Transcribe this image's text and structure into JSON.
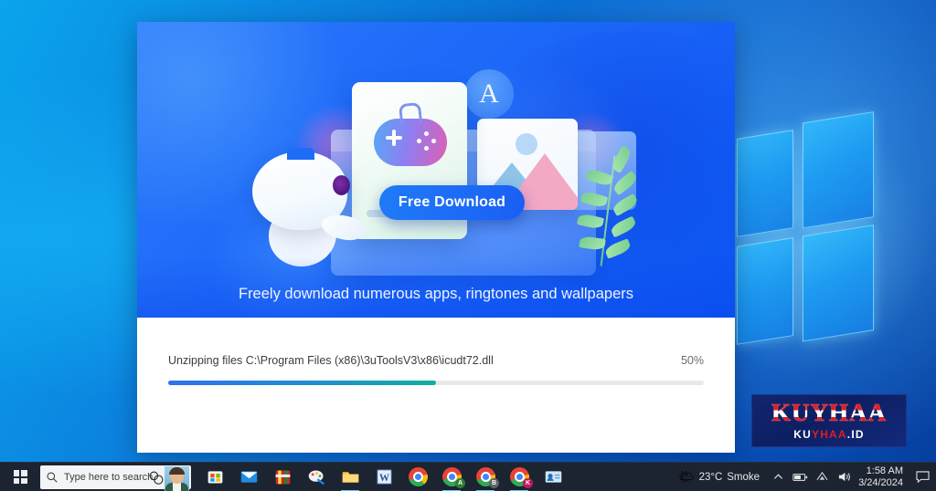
{
  "desktop": {
    "os_logo": "windows-logo"
  },
  "installer": {
    "banner": {
      "button_label": "Free Download",
      "tagline": "Freely download numerous apps, ringtones and wallpapers",
      "icons": {
        "gamepad": "gamepad-icon",
        "appstore": "A",
        "photo": "photo-icon",
        "mascot": "dolphin-mascot",
        "branch": "leaf-branch"
      }
    },
    "progress": {
      "status": "Unzipping files  C:\\Program Files (x86)\\3uToolsV3\\x86\\icudt72.dll",
      "percent_label": "50%",
      "percent_value": 50,
      "fill_start_color": "#2f72ef",
      "fill_end_color": "#12ae9e",
      "track_color": "#e9e9e9"
    }
  },
  "watermark": {
    "main": "KUYHAA",
    "sub_prefix": "KU",
    "sub_accent": "YHAA",
    "sub_suffix": ".ID",
    "sub_full": "KUYHAA.ID",
    "bg_color": "#12256e",
    "accent_color": "#e11b22"
  },
  "taskbar": {
    "start": "windows-start",
    "search": {
      "placeholder": "Type here to search",
      "icon": "search-icon"
    },
    "cortana": "cortana-icon",
    "avatar": "user-avatar",
    "apps": [
      {
        "name": "microsoft-store",
        "label": "Microsoft Store",
        "type": "store",
        "active": false
      },
      {
        "name": "mail",
        "label": "Mail",
        "type": "mail",
        "active": false
      },
      {
        "name": "winrar",
        "label": "WinRAR",
        "type": "winrar",
        "active": false
      },
      {
        "name": "paint",
        "label": "Paint",
        "type": "paint",
        "active": false
      },
      {
        "name": "file-explorer",
        "label": "File Explorer",
        "type": "folder",
        "active": true
      },
      {
        "name": "word",
        "label": "Word",
        "type": "word",
        "active": false
      },
      {
        "name": "chrome",
        "label": "Google Chrome",
        "type": "chrome",
        "badge": "",
        "active": false
      },
      {
        "name": "chrome-profile-a",
        "label": "Chrome A",
        "type": "chrome",
        "badge": "A",
        "badge_color": "#2e7d32",
        "active": true
      },
      {
        "name": "chrome-profile-b",
        "label": "Chrome B",
        "type": "chrome",
        "badge": "B",
        "badge_color": "#5f6368",
        "active": true
      },
      {
        "name": "chrome-profile-k",
        "label": "Chrome K",
        "type": "chrome",
        "badge": "K",
        "badge_color": "#c2185b",
        "active": true
      },
      {
        "name": "contacts",
        "label": "Contacts",
        "type": "contacts",
        "active": false
      }
    ],
    "tray": {
      "weather_icon": "weather-haze-icon",
      "temperature": "23°C",
      "condition": "Smoke",
      "chevron": "chevron-up-icon",
      "battery": "battery-icon",
      "network": "wifi-icon",
      "volume": "volume-icon",
      "time": "1:58 AM",
      "date": "3/24/2024",
      "action_center": "action-center-icon"
    }
  }
}
